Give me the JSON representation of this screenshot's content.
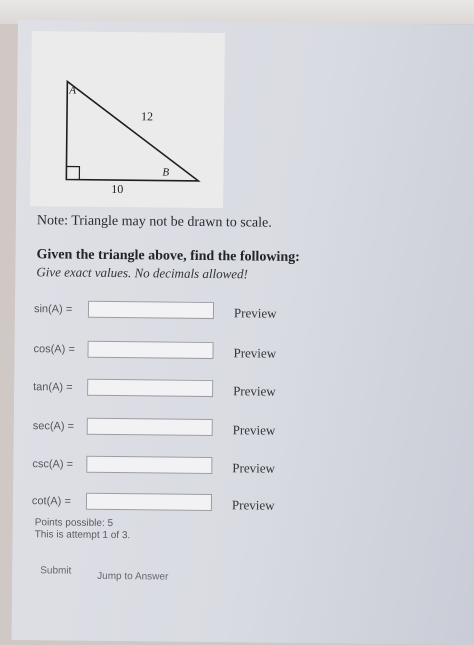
{
  "figure": {
    "vertex_a": "A",
    "vertex_b": "B",
    "hypotenuse": "12",
    "base": "10"
  },
  "note": "Note: Triangle may not be drawn to scale.",
  "heading": "Given the triangle above, find the following:",
  "subheading": "Give exact values. No decimals allowed!",
  "questions": [
    {
      "label": "sin(A) =",
      "value": "",
      "preview": "Preview"
    },
    {
      "label": "cos(A) =",
      "value": "",
      "preview": "Preview"
    },
    {
      "label": "tan(A) =",
      "value": "",
      "preview": "Preview"
    },
    {
      "label": "sec(A) =",
      "value": "",
      "preview": "Preview"
    },
    {
      "label": "csc(A) =",
      "value": "",
      "preview": "Preview"
    },
    {
      "label": "cot(A) =",
      "value": "",
      "preview": "Preview"
    }
  ],
  "points_possible": "Points possible: 5",
  "attempt": "This is attempt 1 of 3.",
  "submit_label": "Submit",
  "jump_label": "Jump to Answer"
}
